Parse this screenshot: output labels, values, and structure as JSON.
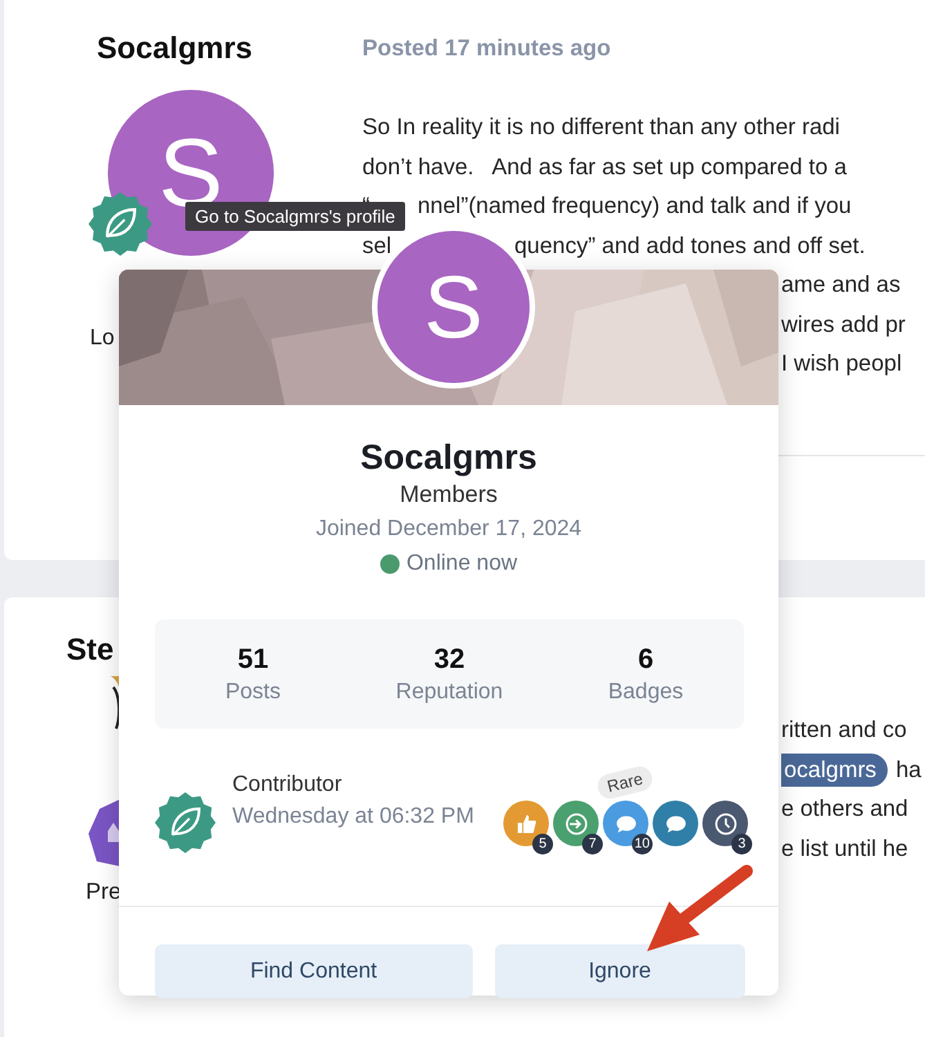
{
  "post": {
    "author": "Socalgmrs",
    "posted": "Posted 17 minutes ago",
    "avatar_letter": "S",
    "tooltip": "Go to Socalgmrs's profile",
    "side_text": "Lo",
    "lines": [
      {
        "left": "So In reality it is no different than any other radi"
      },
      {
        "left": "don’t have.   And as far as set up compared to a"
      },
      {
        "left": "“",
        "right": "nnel”(named frequency) and talk and if you"
      },
      {
        "left": "sel",
        "right": "quency” and add tones and off set."
      },
      {
        "right": "ame and as"
      },
      {
        "right": "wires add pr"
      },
      {
        "right": "I wish peopl"
      }
    ]
  },
  "post_2": {
    "author": "Ste",
    "side_text": "Pre",
    "lines": [
      {
        "text": "ritten and co"
      },
      {
        "mention": "ocalgmrs",
        "text": "ha"
      },
      {
        "text": "e others and"
      },
      {
        "text": "e list until he"
      }
    ]
  },
  "profile_card": {
    "avatar_letter": "S",
    "name": "Socalgmrs",
    "group": "Members",
    "joined": "Joined December 17, 2024",
    "status": {
      "label": "Online now",
      "color": "#4a9a6e"
    },
    "stats": [
      {
        "value": "51",
        "label": "Posts"
      },
      {
        "value": "32",
        "label": "Reputation"
      },
      {
        "value": "6",
        "label": "Badges"
      }
    ],
    "rank": {
      "title": "Contributor",
      "date": "Wednesday at 06:32 PM"
    },
    "badges": [
      {
        "kind": "thumbs-up",
        "color": "#e39a32",
        "count": "5"
      },
      {
        "kind": "sign-in",
        "color": "#4aa06e",
        "count": "7"
      },
      {
        "kind": "chat",
        "color": "#4a9be0",
        "count": "10",
        "tag": "Rare"
      },
      {
        "kind": "chat",
        "color": "#2f7fa8"
      },
      {
        "kind": "clock",
        "color": "#4a5870",
        "count": "3"
      }
    ],
    "buttons": [
      "Find Content",
      "Ignore"
    ]
  }
}
